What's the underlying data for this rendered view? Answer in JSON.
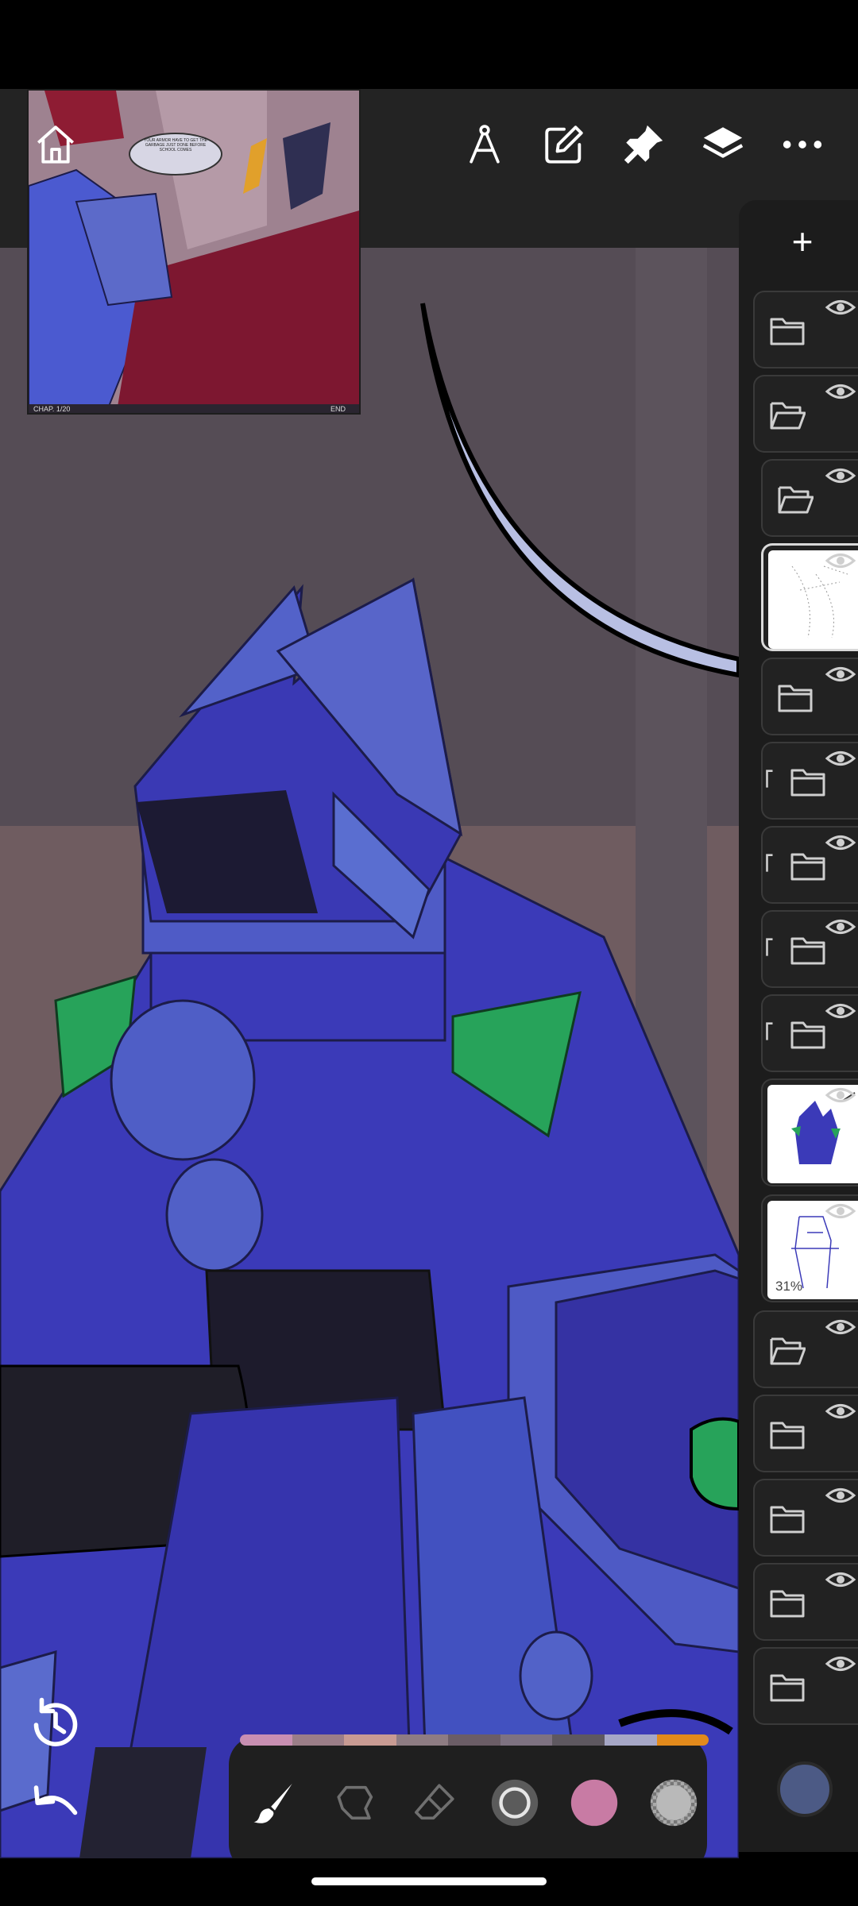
{
  "toolbar": {
    "home_icon": "home-icon",
    "icons": [
      "compass-icon",
      "edit-icon",
      "pin-icon",
      "layers-icon",
      "more-icon"
    ]
  },
  "reference_window": {
    "speech_bubble": "YOUR ARMOR HAVE TO GET THE GARBAGE JUST DONE BEFORE SCHOOL COMES",
    "footer_left": "CHAP. 1/20",
    "footer_right": "END"
  },
  "layers": {
    "add_label": "+",
    "rows": [
      {
        "type": "folder-closed"
      },
      {
        "type": "folder-open"
      },
      {
        "type": "folder-open"
      },
      {
        "type": "sketch-thumb"
      },
      {
        "type": "folder-closed"
      },
      {
        "type": "folder-closed-clip"
      },
      {
        "type": "folder-closed-clip"
      },
      {
        "type": "folder-closed-clip"
      },
      {
        "type": "folder-closed-clip"
      },
      {
        "type": "color-thumb"
      },
      {
        "type": "lineart-thumb",
        "opacity_label": "31%"
      },
      {
        "type": "folder-open"
      },
      {
        "type": "folder-closed"
      },
      {
        "type": "folder-closed"
      },
      {
        "type": "folder-closed"
      },
      {
        "type": "folder-closed"
      }
    ]
  },
  "palette": [
    "#c88fb2",
    "#9b7e88",
    "#c89b93",
    "#8e7c83",
    "#6b5d66",
    "#7e7281",
    "#5e5860",
    "#a6a7c6",
    "#e28a1c"
  ],
  "bottom_tools": [
    "brush-icon",
    "smudge-icon",
    "eraser-icon",
    "brush-size-icon",
    "color-swatch",
    "opacity-icon"
  ],
  "colors": {
    "accent_pink": "#c87ba4",
    "current_color": "#4c5a85",
    "armor_blue": "#3b3ab8",
    "armor_light": "#5562c8",
    "accent_green": "#27a35a"
  }
}
